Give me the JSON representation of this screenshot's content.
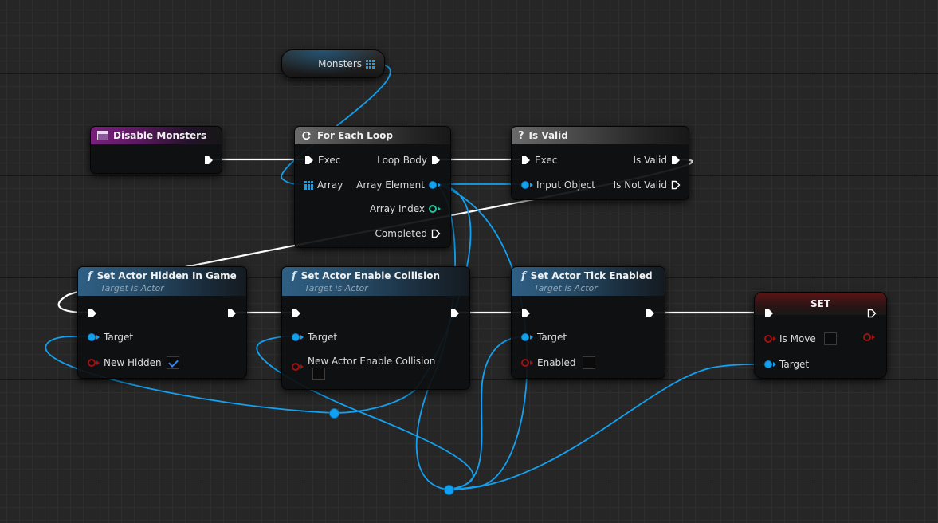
{
  "colors": {
    "exec_wire": "#ffffff",
    "object_wire": "#11a1f0",
    "boolean_pin": "#a01010",
    "integer_pin": "#1fc4a0",
    "event_header": "#7a1f7e",
    "function_header": "#2f5f84",
    "macro_header": "#6a6a6a",
    "set_header": "#5a1414"
  },
  "variable_node": {
    "label": "Monsters",
    "icon": "array-grid-icon"
  },
  "event_node": {
    "title": "Disable Monsters",
    "icon": "event-icon"
  },
  "for_each_loop": {
    "title": "For Each Loop",
    "icon": "loop-icon",
    "inputs": {
      "exec": "Exec",
      "array": "Array"
    },
    "outputs": {
      "loop_body": "Loop Body",
      "array_element": "Array Element",
      "array_index": "Array Index",
      "completed": "Completed"
    }
  },
  "is_valid": {
    "title": "Is Valid",
    "icon": "question-icon",
    "inputs": {
      "exec": "Exec",
      "input_object": "Input Object"
    },
    "outputs": {
      "is_valid": "Is Valid",
      "is_not_valid": "Is Not Valid"
    }
  },
  "set_actor_hidden": {
    "title": "Set Actor Hidden In Game",
    "subtitle": "Target is Actor",
    "icon": "function-icon",
    "inputs": {
      "target": "Target",
      "new_hidden": "New Hidden"
    },
    "new_hidden_checked": true
  },
  "set_actor_collision": {
    "title": "Set Actor Enable Collision",
    "subtitle": "Target is Actor",
    "icon": "function-icon",
    "inputs": {
      "target": "Target",
      "new_enable": "New Actor Enable Collision"
    },
    "new_enable_checked": false
  },
  "set_actor_tick": {
    "title": "Set Actor Tick Enabled",
    "subtitle": "Target is Actor",
    "icon": "function-icon",
    "inputs": {
      "target": "Target",
      "enabled": "Enabled"
    },
    "enabled_checked": false
  },
  "set_node": {
    "title": "SET",
    "inputs": {
      "is_move": "Is Move",
      "target": "Target"
    },
    "is_move_checked": false
  }
}
